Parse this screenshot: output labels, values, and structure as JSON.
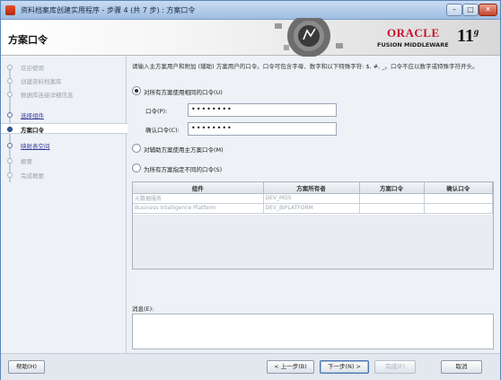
{
  "window": {
    "title": "资料档案库创建实用程序 - 步骤 4 (共 7 步) : 方案口令",
    "controls": {
      "minimize": "–",
      "maximize": "□",
      "close": "✕"
    }
  },
  "banner": {
    "heading": "方案口令",
    "logo": "ORACLE",
    "subtitle": "FUSION MIDDLEWARE",
    "version": "11",
    "version_suffix": "g"
  },
  "sidebar": {
    "steps": [
      {
        "label": "欢迎使用",
        "state": "disabled"
      },
      {
        "label": "创建资料档案库",
        "state": "disabled"
      },
      {
        "label": "数据库连接详细信息",
        "state": "disabled"
      },
      {
        "label": "选择组件",
        "state": "link"
      },
      {
        "label": "方案口令",
        "state": "current"
      },
      {
        "label": "映射表空间",
        "state": "link"
      },
      {
        "label": "概要",
        "state": "disabled"
      },
      {
        "label": "完成概要",
        "state": "disabled"
      }
    ]
  },
  "main": {
    "description": "请输入主方案用户和附加 (辅助) 方案用户的口令。口令可包含字母、数字和以下特殊字符: $, #, _。口令不应以数字或特殊字符开头。",
    "radio_same": "对所有方案使用相同的口令(U)",
    "password_label": "口令(P):",
    "password_value": "••••••••",
    "confirm_label": "确认口令(C):",
    "confirm_value": "••••••••",
    "radio_aux": "对辅助方案使用主方案口令(M)",
    "radio_diff": "为所有方案指定不同的口令(S)",
    "table": {
      "headers": [
        "组件",
        "方案所有者",
        "方案口令",
        "确认口令"
      ],
      "rows": [
        [
          "元数据服务",
          "DEV_MDS",
          "",
          ""
        ],
        [
          "Business Intelligence Platform",
          "DEV_BIPLATFORM",
          "",
          ""
        ]
      ]
    },
    "messages_label": "消息(E):"
  },
  "footer": {
    "help": "帮助(H)",
    "back": "< 上一步(B)",
    "next": "下一步(N) >",
    "finish": "完成(F)",
    "cancel": "取消"
  }
}
